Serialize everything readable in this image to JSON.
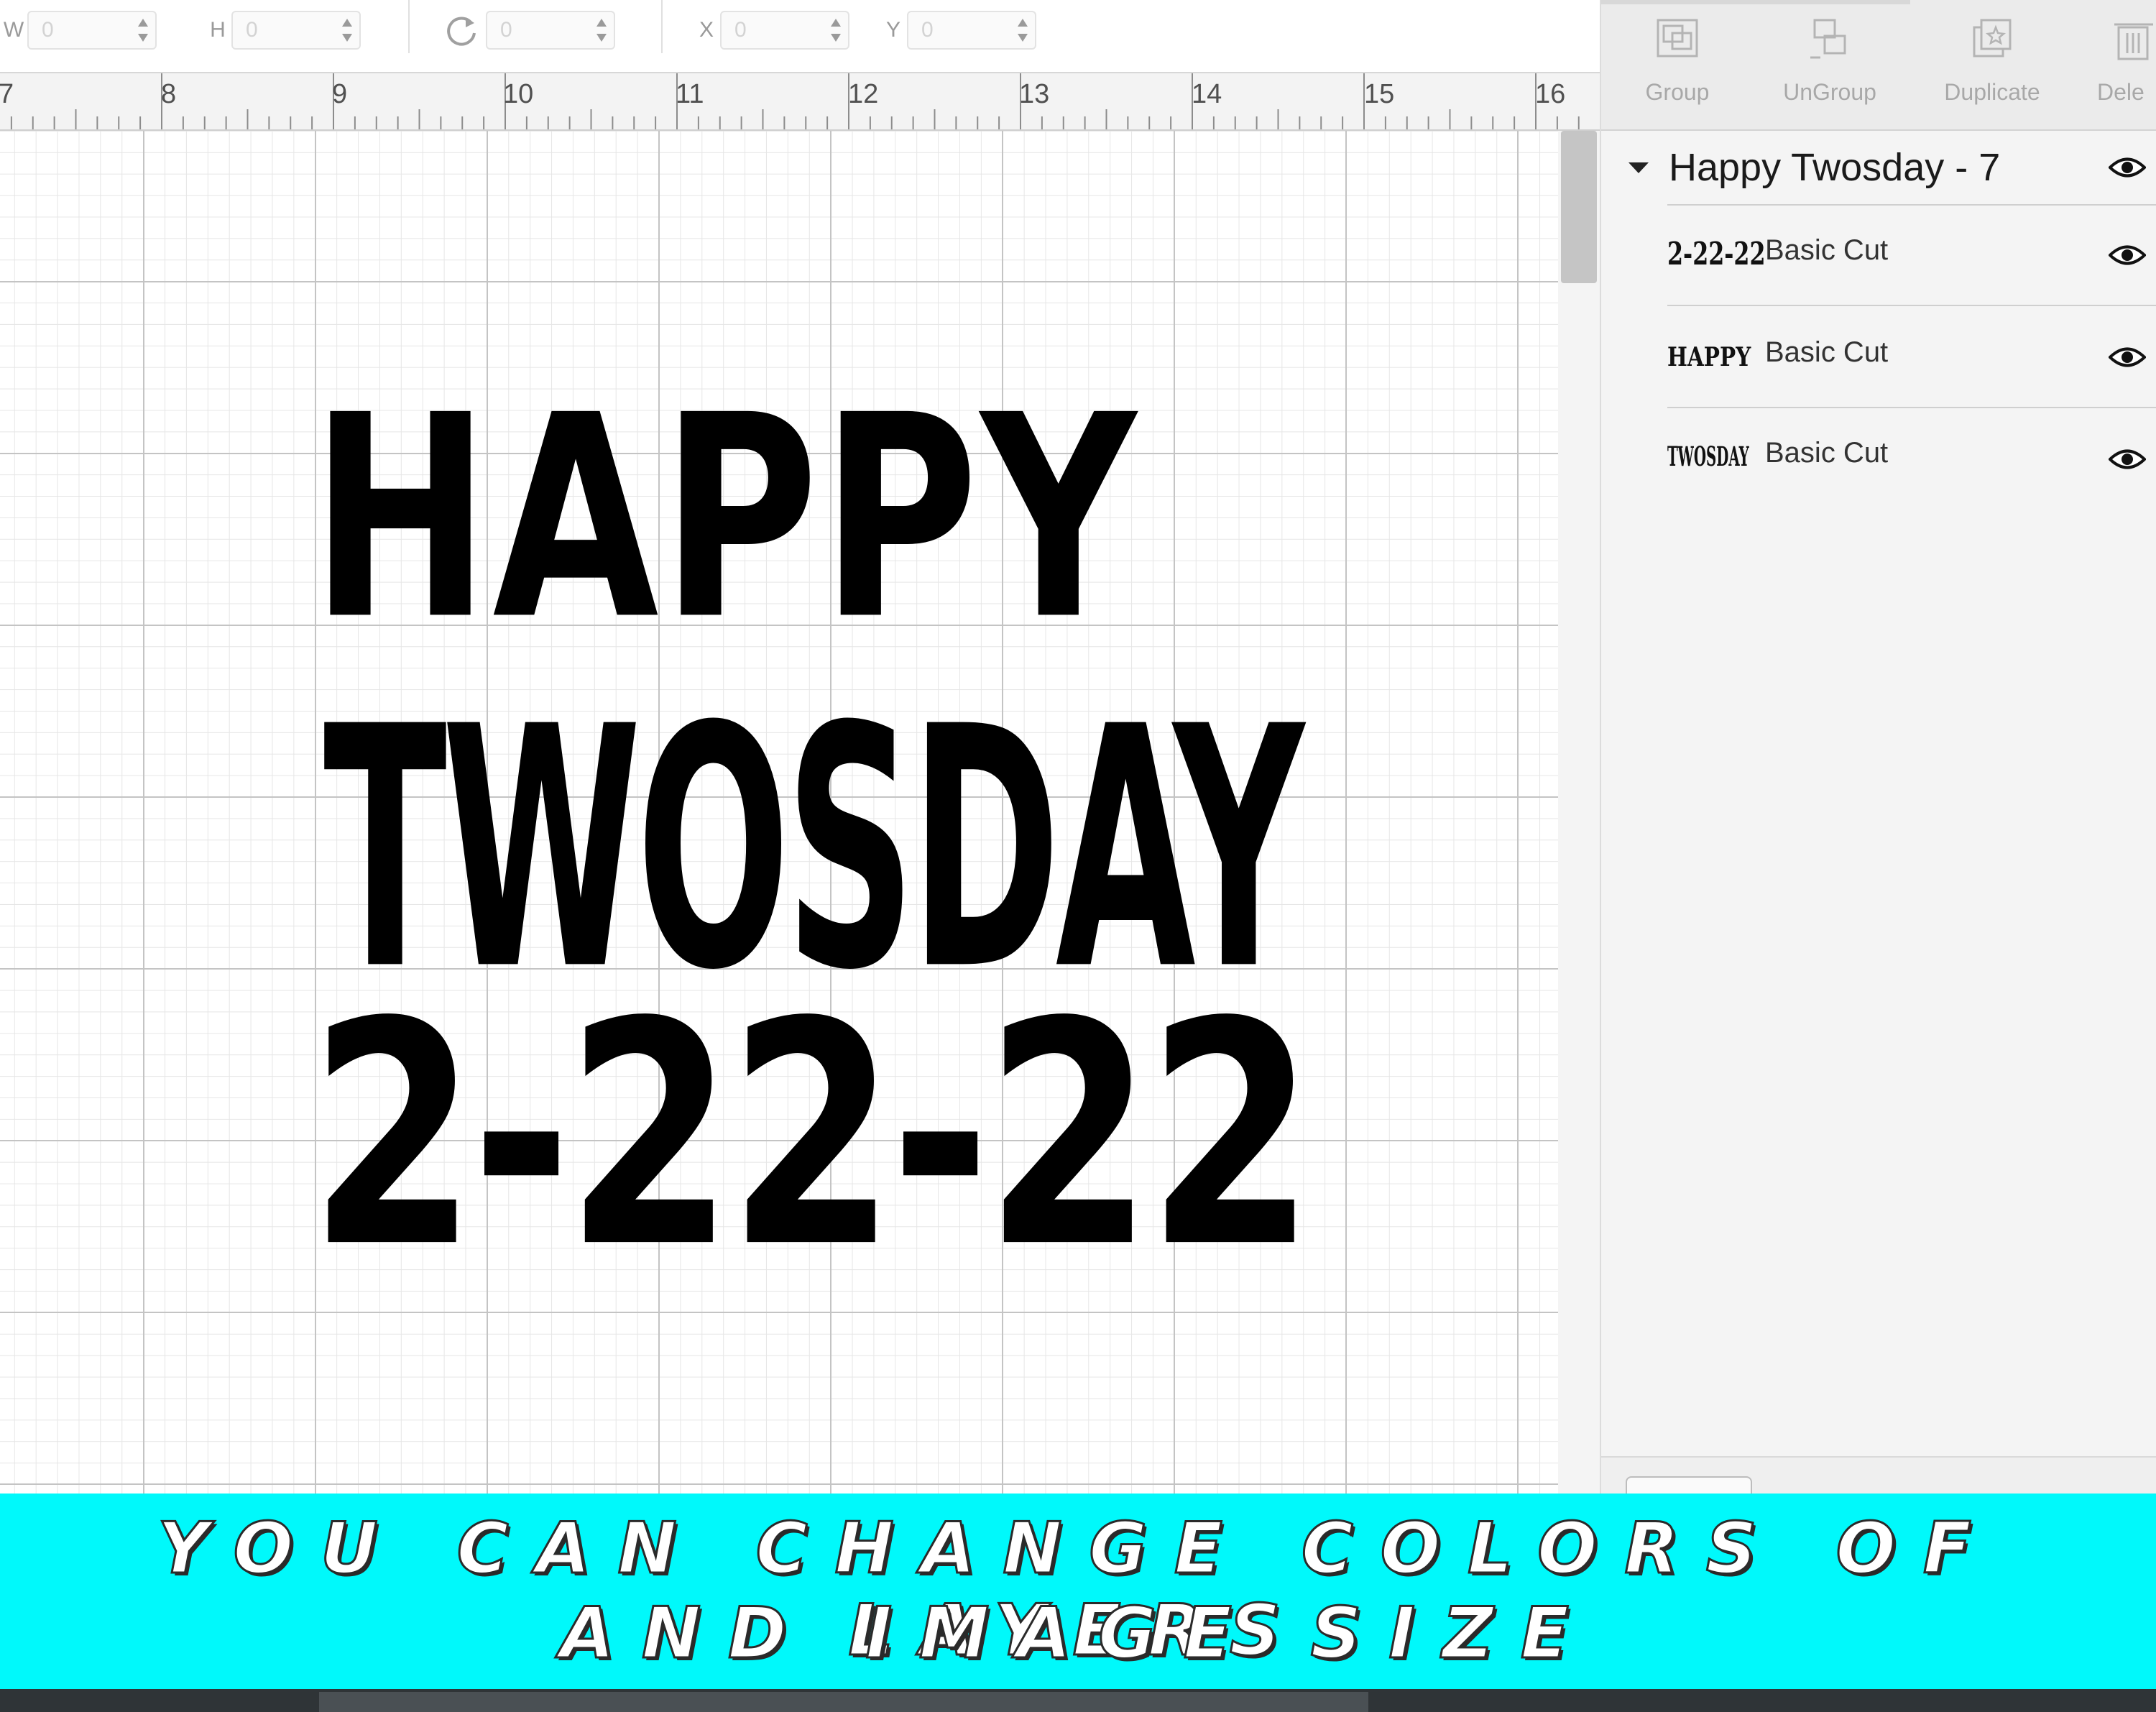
{
  "toolbar": {
    "width": {
      "label": "W",
      "value": "0"
    },
    "height": {
      "label": "H",
      "value": "0"
    },
    "rotate": {
      "value": "0"
    },
    "x": {
      "label": "X",
      "value": "0"
    },
    "y": {
      "label": "Y",
      "value": "0"
    }
  },
  "ruler": {
    "marks": [
      "7",
      "8",
      "9",
      "10",
      "11",
      "12",
      "13",
      "14",
      "15",
      "16"
    ]
  },
  "canvas": {
    "design_lines": [
      "HAPPY",
      "TWOSDAY",
      "2-22-22"
    ]
  },
  "panel": {
    "buttons": {
      "group": "Group",
      "ungroup": "UnGroup",
      "duplicate": "Duplicate",
      "delete": "Dele"
    },
    "group_title": "Happy Twosday - 7",
    "layers": [
      {
        "thumb": "2-22-22",
        "name": "Basic Cut"
      },
      {
        "thumb": "HAPPY",
        "name": "Basic Cut"
      },
      {
        "thumb": "TWOSDAY",
        "name": "Basic Cut"
      }
    ]
  },
  "banner": {
    "line1": "YOU CAN CHANGE COLORS OF LAYERS",
    "line2": "AND IMAGE SIZE",
    "color": "#00f9fb"
  }
}
